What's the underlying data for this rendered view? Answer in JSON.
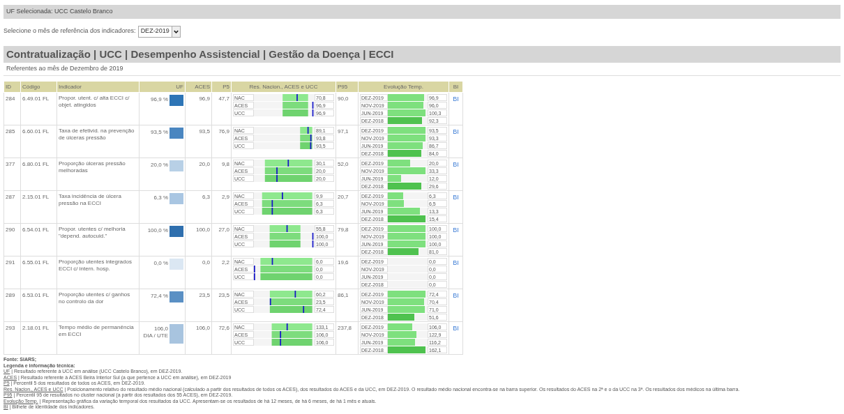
{
  "header": {
    "selected_unit": "UF Selecionada: UCC Castelo Branco"
  },
  "month_selector": {
    "label": "Selecione o mês de referência dos indicadores:",
    "value": "DEZ-2019"
  },
  "section": {
    "title": "Contratualização | UCC | Desempenho Assistencial | Gestão da Doença | ECCI",
    "subtitle": "Referentes ao mês de Dezembro de 2019"
  },
  "table": {
    "columns": [
      "ID",
      "Código",
      "Indicador",
      "UF",
      "ACES",
      "P5",
      "Res. Nacion., ACES e UCC",
      "P95",
      "Evolução Temp.",
      "BI"
    ],
    "rows": [
      {
        "id": "284",
        "code": "6.49.01 FL",
        "indicator": "Propor. utent. c/ alta ECCI c/ objet. atingidos",
        "uf": {
          "value": "96,9 %",
          "color": "#2e75b6"
        },
        "aces": "96,9",
        "p5": "47,7",
        "res": [
          {
            "label": "NAC",
            "value": "70,8"
          },
          {
            "label": "ACES",
            "value": "96,9"
          },
          {
            "label": "UCC",
            "value": "96,9"
          }
        ],
        "p95": "90,0",
        "evolution": [
          {
            "label": "DEZ-2019",
            "value": "96,9"
          },
          {
            "label": "NOV-2019",
            "value": "96,0"
          },
          {
            "label": "JUN-2019",
            "value": "100,3"
          },
          {
            "label": "DEZ-2018",
            "value": "92,3"
          }
        ],
        "bi": "BI"
      },
      {
        "id": "285",
        "code": "6.60.01 FL",
        "indicator": "Taxa de efetivid. na prevenção de úlceras pressão",
        "uf": {
          "value": "93,5 %",
          "color": "#4a86c0"
        },
        "aces": "93,5",
        "p5": "76,9",
        "res": [
          {
            "label": "NAC",
            "value": "89,1"
          },
          {
            "label": "ACES",
            "value": "93,8"
          },
          {
            "label": "UCC",
            "value": "93,5"
          }
        ],
        "p95": "97,1",
        "evolution": [
          {
            "label": "DEZ-2019",
            "value": "93,5"
          },
          {
            "label": "NOV-2019",
            "value": "93,3"
          },
          {
            "label": "JUN-2019",
            "value": "86,7"
          },
          {
            "label": "DEZ-2018",
            "value": "84,0"
          }
        ],
        "bi": "BI"
      },
      {
        "id": "377",
        "code": "6.80.01 FL",
        "indicator": "Proporção úlceras pressão melhoradas",
        "uf": {
          "value": "20,0 %",
          "color": "#b8d0e6"
        },
        "aces": "20,0",
        "p5": "9,8",
        "res": [
          {
            "label": "NAC",
            "value": "30,1"
          },
          {
            "label": "ACES",
            "value": "20,0"
          },
          {
            "label": "UCC",
            "value": "20,0"
          }
        ],
        "p95": "52,0",
        "evolution": [
          {
            "label": "DEZ-2019",
            "value": "20,0"
          },
          {
            "label": "NOV-2019",
            "value": "33,3"
          },
          {
            "label": "JUN-2019",
            "value": "12,0"
          },
          {
            "label": "DEZ-2018",
            "value": "29,6"
          }
        ],
        "bi": "BI"
      },
      {
        "id": "287",
        "code": "2.15.01 FL",
        "indicator": "Taxa incidência de úlcera pressão na ECCI",
        "uf": {
          "value": "6,3 %",
          "color": "#a9c6e2"
        },
        "aces": "6,3",
        "p5": "2,9",
        "res": [
          {
            "label": "NAC",
            "value": "9,9"
          },
          {
            "label": "ACES",
            "value": "6,3"
          },
          {
            "label": "UCC",
            "value": "6,3"
          }
        ],
        "p95": "20,7",
        "evolution": [
          {
            "label": "DEZ-2019",
            "value": "6,3"
          },
          {
            "label": "NOV-2019",
            "value": "6,5"
          },
          {
            "label": "JUN-2019",
            "value": "13,3"
          },
          {
            "label": "DEZ-2018",
            "value": "15,4"
          }
        ],
        "bi": "BI"
      },
      {
        "id": "290",
        "code": "6.54.01 FL",
        "indicator": "Propor. utentes c/ melhoria \"depend. autocuid.\"",
        "uf": {
          "value": "100,0 %",
          "color": "#2f6fae"
        },
        "aces": "100,0",
        "p5": "27,0",
        "res": [
          {
            "label": "NAC",
            "value": "55,8"
          },
          {
            "label": "ACES",
            "value": "100,0"
          },
          {
            "label": "UCC",
            "value": "100,0"
          }
        ],
        "p95": "79,8",
        "evolution": [
          {
            "label": "DEZ-2019",
            "value": "100,0"
          },
          {
            "label": "NOV-2019",
            "value": "100,0"
          },
          {
            "label": "JUN-2019",
            "value": "100,0"
          },
          {
            "label": "DEZ-2018",
            "value": "81,0"
          }
        ],
        "bi": "BI"
      },
      {
        "id": "291",
        "code": "6.55.01 FL",
        "indicator": "Proporção utentes integrados ECCI c/ intern. hosp.",
        "uf": {
          "value": "0,0 %",
          "color": "#dbe7f3"
        },
        "aces": "0,0",
        "p5": "2,2",
        "res": [
          {
            "label": "NAC",
            "value": "6,0"
          },
          {
            "label": "ACES",
            "value": "0,0"
          },
          {
            "label": "UCC",
            "value": "0,0"
          }
        ],
        "p95": "19,6",
        "evolution": [
          {
            "label": "DEZ-2019",
            "value": "0,0"
          },
          {
            "label": "NOV-2019",
            "value": "0,0"
          },
          {
            "label": "JUN-2019",
            "value": "0,0"
          },
          {
            "label": "DEZ-2018",
            "value": "0,0"
          }
        ],
        "bi": "BI"
      },
      {
        "id": "289",
        "code": "6.53.01 FL",
        "indicator": "Proporção utentes c/ ganhos no controlo da dor",
        "uf": {
          "value": "72,4 %",
          "color": "#5a90c4"
        },
        "aces": "23,5",
        "p5": "23,5",
        "res": [
          {
            "label": "NAC",
            "value": "60,2"
          },
          {
            "label": "ACES",
            "value": "23,5"
          },
          {
            "label": "UCC",
            "value": "72,4"
          }
        ],
        "p95": "86,1",
        "evolution": [
          {
            "label": "DEZ-2019",
            "value": "72,4"
          },
          {
            "label": "NOV-2019",
            "value": "70,4"
          },
          {
            "label": "JUN-2019",
            "value": "71,0"
          },
          {
            "label": "DEZ-2018",
            "value": "51,6"
          }
        ],
        "bi": "BI"
      },
      {
        "id": "293",
        "code": "2.18.01 FL",
        "indicator": "Tempo médio de permanência em ECCI",
        "uf": {
          "value": "106,0",
          "unit": "DIA / UTE",
          "color": "#a8c4df"
        },
        "aces": "106,0",
        "p5": "72,6",
        "res": [
          {
            "label": "NAC",
            "value": "133,1"
          },
          {
            "label": "ACES",
            "value": "106,0"
          },
          {
            "label": "UCC",
            "value": "106,0"
          }
        ],
        "p95": "237,8",
        "evolution": [
          {
            "label": "DEZ-2019",
            "value": "106,0"
          },
          {
            "label": "NOV-2019",
            "value": "122,9"
          },
          {
            "label": "JUN-2019",
            "value": "116,2"
          },
          {
            "label": "DEZ-2018",
            "value": "162,1"
          }
        ],
        "bi": "BI"
      }
    ]
  },
  "footer": {
    "source": "Fonte: SIARS;",
    "legend_title": "Legenda e informação técnica:",
    "items": [
      {
        "term": "UF",
        "text": " | Resultado referente à UCC em análise (UCC Castelo Branco), em DEZ-2019."
      },
      {
        "term": "ACES",
        "text": " | Resultado referente à ACES Beira Interior Sul (a que pertence a UCC em análise), em DEZ-2019"
      },
      {
        "term": "P5",
        "text": " | Percentil 5 dos resultados de todos os ACES, em DEZ-2019."
      },
      {
        "term": "Res. Nacion., ACES e UCC",
        "text": " | Posicionamento relativo do resultado médio nacional (calculado a partir dos resultados de todos os ACES), dos resultados do ACES e da UCC, em DEZ-2019. O resultado médio nacional encontra-se na barra superior. Os resultados do ACES na 2ª e o da UCC na 3ª. Os resultados dos médicos na última barra."
      },
      {
        "term": "P95",
        "text": " | Percentil 95 de resultados no cluster nacional (a partir dos resultados dos 55 ACES), em DEZ-2019."
      },
      {
        "term": "Evolução Temp.",
        "text": " | Representação gráfica da variação temporal dos resultados da UCC. Apresentam-se os resultados de há 12 meses, de há 6 meses, de há 1 mês e atuais."
      },
      {
        "term": "BI",
        "text": " | Bilhete de identidade dos indicadores."
      }
    ]
  }
}
